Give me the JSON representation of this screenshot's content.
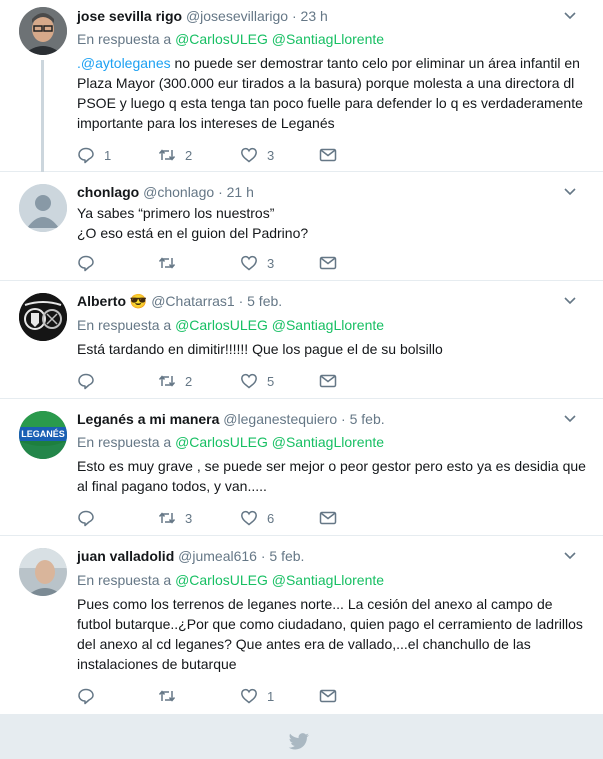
{
  "tweets": [
    {
      "name": "jose sevilla rigo",
      "handle": "@josesevillarigo",
      "time": "· 23 h",
      "reply_prefix": "En respuesta a",
      "reply_to": [
        "@CarlosULEG",
        "@SantiagLlorente"
      ],
      "mention": ".@aytoleganes",
      "text": " no puede ser demostrar tanto celo por eliminar un área infantil en Plaza Mayor (300.000 eur tirados a la basura) porque molesta a una directora dl PSOE y luego q esta tenga tan poco fuelle para defender lo q es verdaderamente importante para los intereses de Leganés",
      "replies": "1",
      "retweets": "2",
      "likes": "3"
    },
    {
      "name": "chonlago",
      "handle": "@chonlago",
      "time": "· 21 h",
      "text_lines": [
        "Ya sabes “primero los nuestros”",
        "¿O eso está en el guion del Padrino?"
      ],
      "replies": "",
      "retweets": "",
      "likes": "3"
    },
    {
      "name": "Alberto",
      "emoji": "😎",
      "handle": "@Chatarras1",
      "time": "· 5 feb.",
      "reply_prefix": "En respuesta a",
      "reply_to": [
        "@CarlosULEG",
        "@SantiagLlorente"
      ],
      "text": "Está tardando en dimitir!!!!!! Que los pague el de su bolsillo",
      "replies": "",
      "retweets": "2",
      "likes": "5"
    },
    {
      "name": "Leganés a mi manera",
      "handle": "@leganestequiero",
      "time": "· 5 feb.",
      "reply_prefix": "En respuesta a",
      "reply_to": [
        "@CarlosULEG",
        "@SantiagLlorente"
      ],
      "text": "Esto es muy grave , se puede ser mejor o peor gestor pero esto ya es desidia que al final pagano todos, y van.....",
      "replies": "",
      "retweets": "3",
      "likes": "6"
    },
    {
      "name": "juan valladolid",
      "handle": "@jumeal616",
      "time": "· 5 feb.",
      "reply_prefix": "En respuesta a",
      "reply_to": [
        "@CarlosULEG",
        "@SantiagLlorente"
      ],
      "text": "Pues como los terrenos de leganes norte... La cesión del anexo al campo de futbol butarque..¿Por que como ciudadano, quien pago el cerramiento de ladrillos del anexo al cd leganes? Que antes era de vallado,...el chanchullo de las instalaciones de butarque",
      "replies": "",
      "retweets": "",
      "likes": "1"
    }
  ],
  "avatar_labels": {
    "t4": "LEGANÉS"
  },
  "colors": {
    "accent": "#1da1f2",
    "mention": "#17bf63",
    "muted": "#657786"
  }
}
